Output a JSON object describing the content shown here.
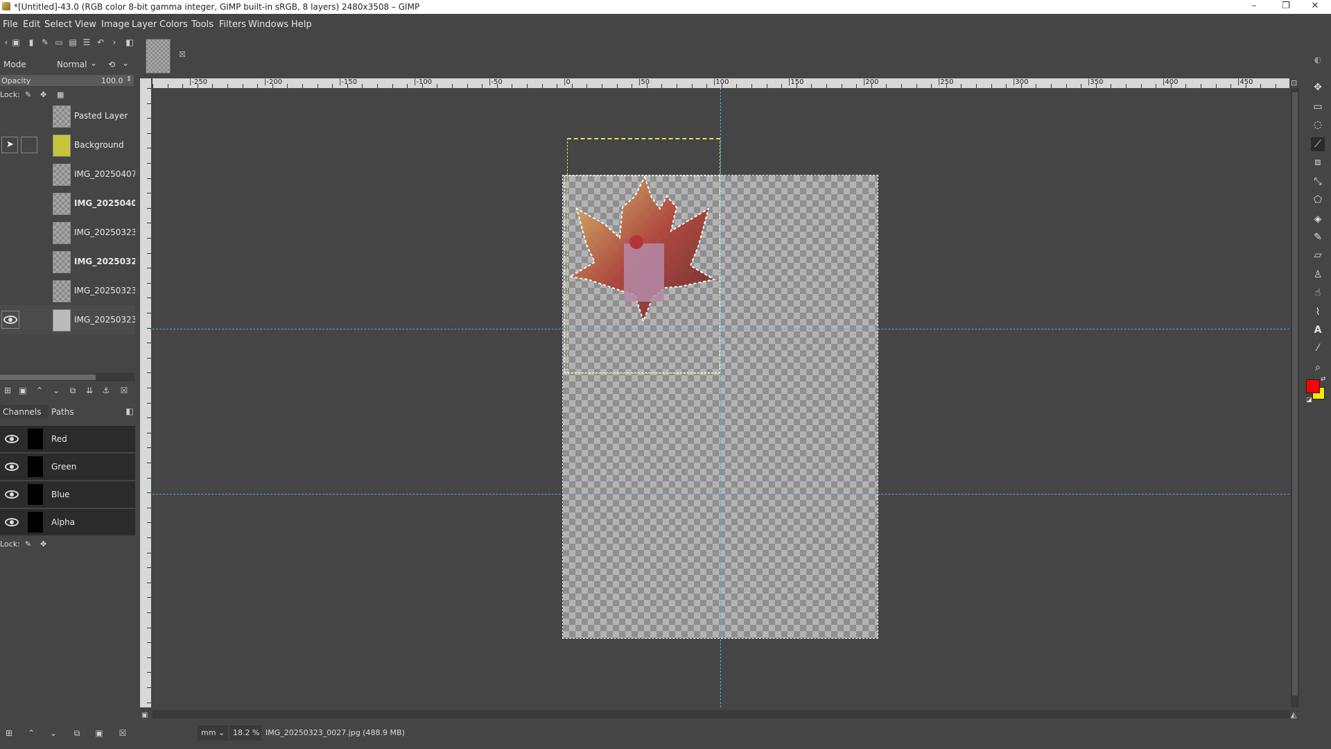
{
  "window": {
    "title": "*[Untitled]-43.0 (RGB color 8-bit gamma integer, GIMP built-in sRGB, 8 layers) 2480x3508 – GIMP",
    "minimize": "–",
    "maximize": "❐",
    "close": "✕"
  },
  "menubar": [
    "File",
    "Edit",
    "Select",
    "View",
    "Image",
    "Layer",
    "Colors",
    "Tools",
    "Filters",
    "Windows",
    "Help"
  ],
  "layers_panel": {
    "mode_label": "Mode",
    "mode_value": "Normal",
    "opacity_label": "Opacity",
    "opacity_value": "100.0",
    "lock_label": "Lock:",
    "layers": [
      {
        "name": "Pasted Layer",
        "bold": false
      },
      {
        "name": "Background",
        "bold": false
      },
      {
        "name": "IMG_20250407",
        "bold": false
      },
      {
        "name": "IMG_2025040",
        "bold": true
      },
      {
        "name": "IMG_20250323",
        "bold": false
      },
      {
        "name": "IMG_2025032",
        "bold": true
      },
      {
        "name": "IMG_20250323",
        "bold": false
      },
      {
        "name": "IMG_20250323",
        "bold": false
      }
    ]
  },
  "channels_panel": {
    "tabs": [
      "Channels",
      "Paths"
    ],
    "channels": [
      "Red",
      "Green",
      "Blue",
      "Alpha"
    ],
    "lock_label": "Lock:"
  },
  "ruler_top_labels": [
    "|-250",
    "|-200",
    "|-150",
    "|-100",
    "|-50",
    "|0",
    "|50",
    "|100",
    "|150",
    "|200",
    "|250",
    "|300",
    "|350",
    "|400",
    "|450"
  ],
  "statusbar": {
    "unit": "mm",
    "zoom": "18.2 %",
    "info": "IMG_20250323_0027.jpg (488.9 MB)"
  },
  "colors": {
    "foreground": "#ff0000",
    "background": "#f5ea00",
    "guide": "#4fa9d6"
  },
  "tools": [
    "move-icon",
    "rect-select-icon",
    "lasso-icon",
    "fuzzy-select-icon",
    "crop-icon",
    "transform-icon",
    "perspective-icon",
    "bucket-fill-icon",
    "paintbrush-icon",
    "eraser-icon",
    "clone-icon",
    "smudge-icon",
    "paths-icon",
    "text-icon",
    "color-picker-icon",
    "zoom-icon"
  ]
}
